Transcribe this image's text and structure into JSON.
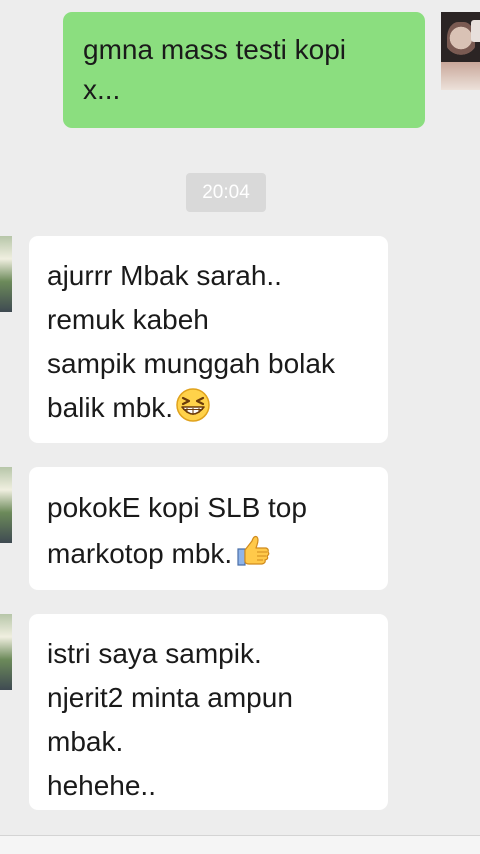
{
  "conversation": {
    "outgoing": [
      {
        "lines": [
          "gmna mass testi kopi",
          "x..."
        ]
      }
    ],
    "timestamp": "20:04",
    "incoming": [
      {
        "lines": [
          "ajurrr Mbak sarah..",
          "remuk kabeh",
          "sampik munggah bolak",
          "balik mbk."
        ],
        "emoji": "grinning-squint-emoji"
      },
      {
        "lines": [
          "pokokE kopi SLB top",
          "markotop mbk."
        ],
        "emoji": "thumbs-up-emoji"
      },
      {
        "lines": [
          "istri saya sampik.",
          "njerit2 minta ampun",
          "mbak.",
          "hehehe.."
        ]
      }
    ]
  },
  "colors": {
    "background": "#ededed",
    "outgoing_bubble": "#8bde7f",
    "incoming_bubble": "#ffffff",
    "timestamp_bg": "#d9d9d9"
  }
}
